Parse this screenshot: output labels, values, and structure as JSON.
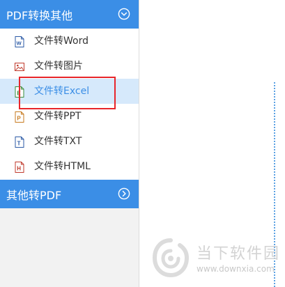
{
  "sidebar": {
    "section1": {
      "title": "PDF转换其他"
    },
    "items": [
      {
        "label": "文件转Word",
        "icon": "word-file-icon",
        "active": false
      },
      {
        "label": "文件转图片",
        "icon": "image-file-icon",
        "active": false
      },
      {
        "label": "文件转Excel",
        "icon": "excel-file-icon",
        "active": true
      },
      {
        "label": "文件转PPT",
        "icon": "ppt-file-icon",
        "active": false
      },
      {
        "label": "文件转TXT",
        "icon": "txt-file-icon",
        "active": false
      },
      {
        "label": "文件转HTML",
        "icon": "html-file-icon",
        "active": false
      }
    ],
    "section2": {
      "title": "其他转PDF"
    }
  },
  "watermark": {
    "name": "当下软件园",
    "url": "www.downxia.com"
  },
  "colors": {
    "accent": "#3b8ee6",
    "active_bg": "#d6e9fb",
    "highlight": "#e8252a",
    "word": "#2b5aa6",
    "image": "#c0392b",
    "excel": "#3a8b3a",
    "ppt": "#c77a1e",
    "txt": "#2b5aa6",
    "html": "#c0392b"
  }
}
